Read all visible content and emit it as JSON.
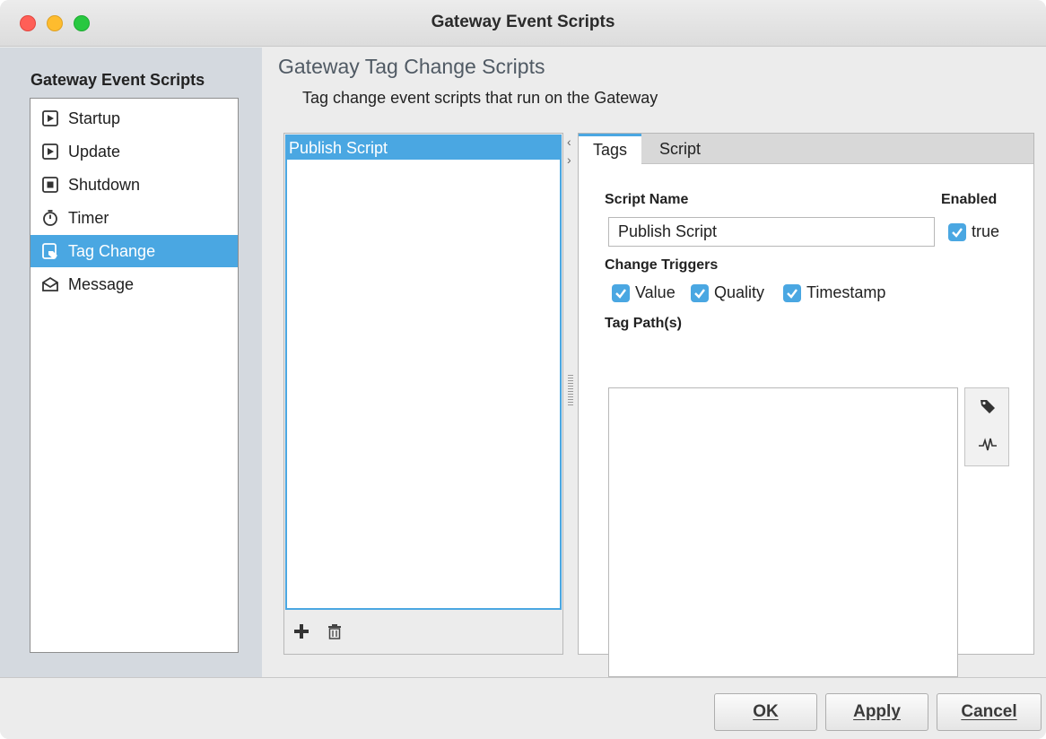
{
  "window": {
    "title": "Gateway Event Scripts"
  },
  "sidebar": {
    "heading": "Gateway Event Scripts",
    "items": [
      {
        "label": "Startup",
        "icon": "play-doc-icon"
      },
      {
        "label": "Update",
        "icon": "play-doc-icon"
      },
      {
        "label": "Shutdown",
        "icon": "stop-doc-icon"
      },
      {
        "label": "Timer",
        "icon": "timer-icon"
      },
      {
        "label": "Tag Change",
        "icon": "tag-change-icon",
        "selected": true
      },
      {
        "label": "Message",
        "icon": "envelope-icon"
      }
    ]
  },
  "main": {
    "title": "Gateway Tag Change Scripts",
    "subtitle": "Tag change event scripts that run on the Gateway",
    "scripts": [
      "Publish Script"
    ],
    "tabs": [
      {
        "label": "Tags",
        "active": true
      },
      {
        "label": "Script",
        "active": false
      }
    ],
    "form": {
      "script_name_label": "Script Name",
      "script_name_value": "Publish Script",
      "enabled_label": "Enabled",
      "enabled_value": "true",
      "triggers_label": "Change Triggers",
      "triggers": [
        {
          "label": "Value",
          "checked": true
        },
        {
          "label": "Quality",
          "checked": true
        },
        {
          "label": "Timestamp",
          "checked": true
        }
      ],
      "tag_paths_label": "Tag Path(s)"
    }
  },
  "footer": {
    "ok_label": "OK",
    "apply_label": "Apply",
    "cancel_label": "Cancel"
  },
  "colors": {
    "accent": "#4aa7e2",
    "sidebar_bg": "#d4d9df"
  }
}
